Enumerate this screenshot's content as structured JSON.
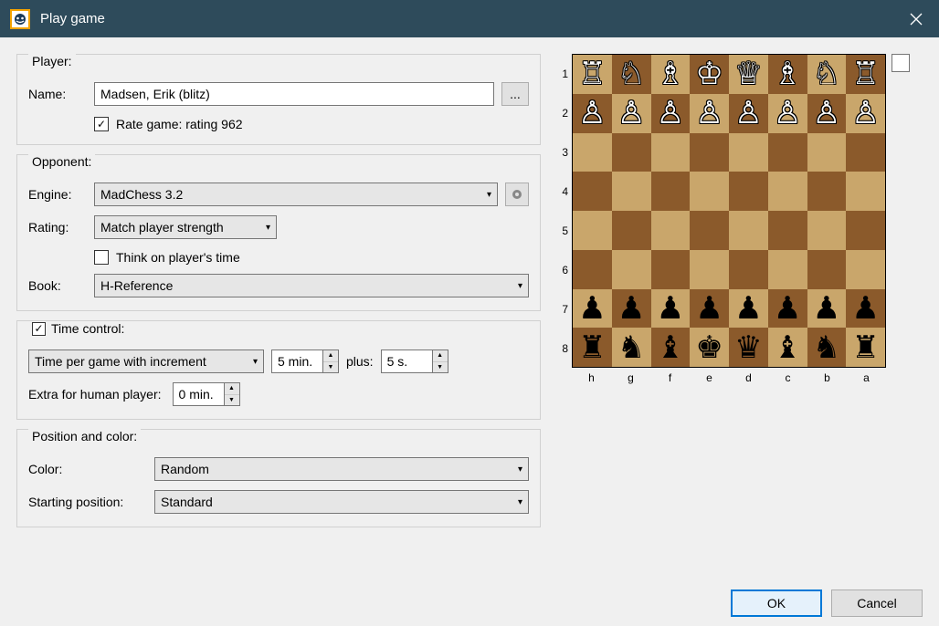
{
  "window": {
    "title": "Play game"
  },
  "player": {
    "section": "Player:",
    "name_label": "Name:",
    "name_value": "Madsen, Erik (blitz)",
    "rate_label": "Rate game: rating 962",
    "rate_checked": true
  },
  "opponent": {
    "section": "Opponent:",
    "engine_label": "Engine:",
    "engine_value": "MadChess 3.2",
    "rating_label": "Rating:",
    "rating_value": "Match player strength",
    "think_label": "Think on player's time",
    "think_checked": false,
    "book_label": "Book:",
    "book_value": "H-Reference"
  },
  "time": {
    "section": "Time control:",
    "section_checked": true,
    "mode": "Time per game with increment",
    "time_value": "5 min.",
    "plus": "plus:",
    "inc_value": "5 s.",
    "extra_label": "Extra for human player:",
    "extra_value": "0 min."
  },
  "position": {
    "section": "Position and color:",
    "color_label": "Color:",
    "color_value": "Random",
    "start_label": "Starting position:",
    "start_value": "Standard"
  },
  "buttons": {
    "ok": "OK",
    "cancel": "Cancel",
    "ellipsis": "..."
  },
  "board": {
    "ranks": [
      "1",
      "2",
      "3",
      "4",
      "5",
      "6",
      "7",
      "8"
    ],
    "files": [
      "h",
      "g",
      "f",
      "e",
      "d",
      "c",
      "b",
      "a"
    ],
    "rows": [
      [
        {
          "p": "♖",
          "c": "w"
        },
        {
          "p": "♘",
          "c": "w"
        },
        {
          "p": "♗",
          "c": "w"
        },
        {
          "p": "♔",
          "c": "w"
        },
        {
          "p": "♕",
          "c": "w"
        },
        {
          "p": "♗",
          "c": "w"
        },
        {
          "p": "♘",
          "c": "w"
        },
        {
          "p": "♖",
          "c": "w"
        }
      ],
      [
        {
          "p": "♙",
          "c": "w"
        },
        {
          "p": "♙",
          "c": "w"
        },
        {
          "p": "♙",
          "c": "w"
        },
        {
          "p": "♙",
          "c": "w"
        },
        {
          "p": "♙",
          "c": "w"
        },
        {
          "p": "♙",
          "c": "w"
        },
        {
          "p": "♙",
          "c": "w"
        },
        {
          "p": "♙",
          "c": "w"
        }
      ],
      [
        null,
        null,
        null,
        null,
        null,
        null,
        null,
        null
      ],
      [
        null,
        null,
        null,
        null,
        null,
        null,
        null,
        null
      ],
      [
        null,
        null,
        null,
        null,
        null,
        null,
        null,
        null
      ],
      [
        null,
        null,
        null,
        null,
        null,
        null,
        null,
        null
      ],
      [
        {
          "p": "♟",
          "c": "b"
        },
        {
          "p": "♟",
          "c": "b"
        },
        {
          "p": "♟",
          "c": "b"
        },
        {
          "p": "♟",
          "c": "b"
        },
        {
          "p": "♟",
          "c": "b"
        },
        {
          "p": "♟",
          "c": "b"
        },
        {
          "p": "♟",
          "c": "b"
        },
        {
          "p": "♟",
          "c": "b"
        }
      ],
      [
        {
          "p": "♜",
          "c": "b"
        },
        {
          "p": "♞",
          "c": "b"
        },
        {
          "p": "♝",
          "c": "b"
        },
        {
          "p": "♚",
          "c": "b"
        },
        {
          "p": "♛",
          "c": "b"
        },
        {
          "p": "♝",
          "c": "b"
        },
        {
          "p": "♞",
          "c": "b"
        },
        {
          "p": "♜",
          "c": "b"
        }
      ]
    ]
  }
}
